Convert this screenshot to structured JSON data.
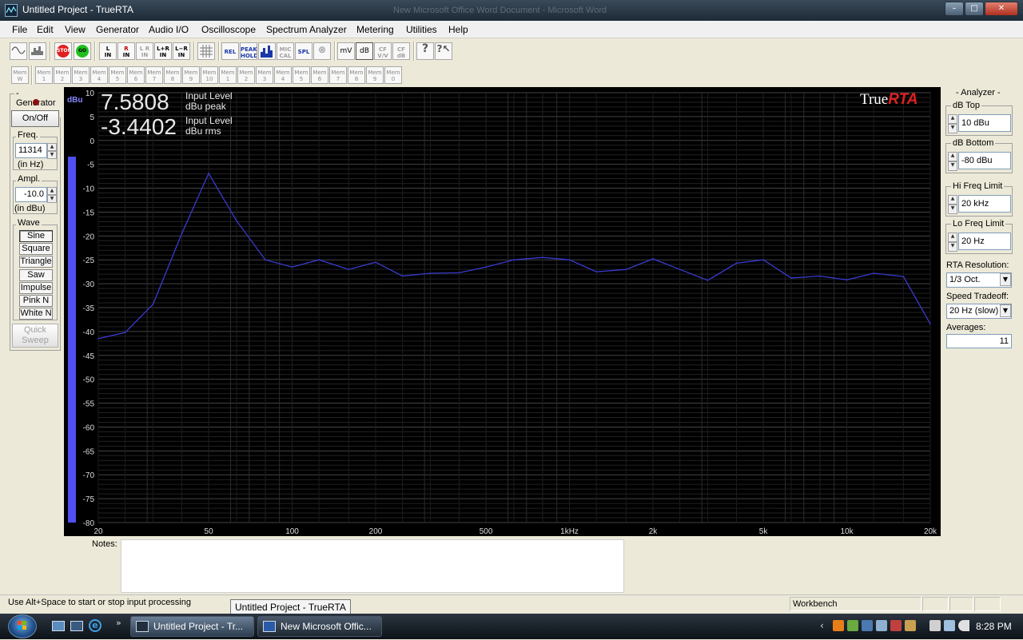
{
  "window": {
    "title": "Untitled Project - TrueRTA",
    "background_title": "New Microsoft Office Word Document - Microsoft Word"
  },
  "menu": [
    "File",
    "Edit",
    "View",
    "Generator",
    "Audio I/O",
    "Oscilloscope",
    "Spectrum Analyzer",
    "Metering",
    "Utilities",
    "Help"
  ],
  "toolbar": {
    "stop": "STOP",
    "go": "GO",
    "l_in": [
      "L",
      "IN"
    ],
    "r_in": [
      "R",
      "IN"
    ],
    "lr_in": [
      "L R",
      "IN"
    ],
    "lplusr_in": [
      "L+R",
      "IN"
    ],
    "lminusr_in": [
      "L−R",
      "IN"
    ],
    "rel": "REL",
    "peak_hold": [
      "PEAK",
      "HOLD"
    ],
    "mic_cal": [
      "MIC",
      "CAL"
    ],
    "spl": "SPL",
    "mv": "mV",
    "db": "dB",
    "cf_vv": [
      "CF",
      "V/V"
    ],
    "cf_db": [
      "CF",
      "dB"
    ]
  },
  "memory": {
    "prefix": "Mem",
    "slots": [
      "W",
      "1",
      "2",
      "3",
      "4",
      "5",
      "6",
      "7",
      "8",
      "9",
      "10",
      "1",
      "2",
      "3",
      "4",
      "5",
      "6",
      "7",
      "8",
      "9",
      "0"
    ]
  },
  "generator": {
    "title": "Generator",
    "onoff": "On/Off",
    "freq_label": "Freq.",
    "freq_value": "11314",
    "freq_unit": "(in Hz)",
    "ampl_label": "Ampl.",
    "ampl_value": "-10.0",
    "ampl_unit": "(in dBu)",
    "wave_label": "Wave",
    "waves": [
      "Sine",
      "Square",
      "Triangle",
      "Saw",
      "Impulse",
      "Pink N",
      "White N"
    ],
    "active_wave": "Sine",
    "quick_sweep": [
      "Quick",
      "Sweep"
    ]
  },
  "analyzer": {
    "title": "Analyzer",
    "db_top_label": "dB Top",
    "db_top": "10 dBu",
    "db_bottom_label": "dB Bottom",
    "db_bottom": "-80 dBu",
    "hi_freq_label": "Hi Freq Limit",
    "hi_freq": "20 kHz",
    "lo_freq_label": "Lo Freq Limit",
    "lo_freq": "20 Hz",
    "resolution_label": "RTA Resolution:",
    "resolution": "1/3 Oct.",
    "speed_label": "Speed Tradeoff:",
    "speed": "20 Hz (slow)",
    "averages_label": "Averages:",
    "averages": "11"
  },
  "readout": {
    "peak_value": "7.5808",
    "peak_label1": "Input Level",
    "peak_label2": "dBu peak",
    "rms_value": "-3.4402",
    "rms_label1": "Input Level",
    "rms_label2": "dBu rms"
  },
  "logo": {
    "part1": "True",
    "part2": "RTA"
  },
  "chart_data": {
    "type": "line",
    "title": "",
    "xlabel": "",
    "ylabel": "dBu",
    "x_scale": "log",
    "xlim": [
      20,
      20000
    ],
    "ylim": [
      -80,
      10
    ],
    "x_ticks": [
      {
        "v": 20,
        "t": "20"
      },
      {
        "v": 50,
        "t": "50"
      },
      {
        "v": 100,
        "t": "100"
      },
      {
        "v": 200,
        "t": "200"
      },
      {
        "v": 500,
        "t": "500"
      },
      {
        "v": 1000,
        "t": "1kHz"
      },
      {
        "v": 2000,
        "t": "2k"
      },
      {
        "v": 5000,
        "t": "5k"
      },
      {
        "v": 10000,
        "t": "10k"
      },
      {
        "v": 20000,
        "t": "20k"
      }
    ],
    "y_ticks": [
      10,
      5,
      0,
      -5,
      -10,
      -15,
      -20,
      -25,
      -30,
      -35,
      -40,
      -45,
      -50,
      -55,
      -60,
      -65,
      -70,
      -75,
      -80
    ],
    "grid": true,
    "meter_level": -3.4,
    "series": [
      {
        "color": "#3a3ad0",
        "x": [
          20,
          25,
          31.5,
          40,
          50,
          63,
          80,
          100,
          125,
          160,
          200,
          250,
          315,
          400,
          500,
          630,
          800,
          1000,
          1250,
          1600,
          2000,
          2500,
          3150,
          4000,
          5000,
          6300,
          8000,
          10000,
          12500,
          16000,
          20000
        ],
        "y": [
          -41.5,
          -40.2,
          -34.3,
          -19.5,
          -6.9,
          -16.8,
          -25,
          -26.5,
          -25,
          -27,
          -25.5,
          -28.4,
          -27.8,
          -27.7,
          -26.5,
          -25,
          -24.5,
          -25,
          -27.5,
          -27,
          -24.8,
          -27,
          -29.3,
          -25.7,
          -25,
          -28.8,
          -28.4,
          -29.2,
          -27.8,
          -28.5,
          -38.4
        ]
      }
    ]
  },
  "notes": {
    "label": "Notes:",
    "text": ""
  },
  "status": {
    "message": "Use Alt+Space to start or stop input processing",
    "mode": "Workbench",
    "tooltip": "Untitled Project - TrueRTA"
  },
  "taskbar": {
    "buttons": [
      {
        "label": "Untitled Project - Tr...",
        "active": true
      },
      {
        "label": "New Microsoft Offic...",
        "active": false
      }
    ],
    "clock": "8:28 PM"
  }
}
